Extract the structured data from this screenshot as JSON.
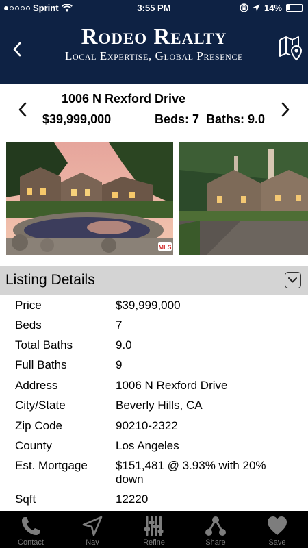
{
  "status_bar": {
    "carrier": "Sprint",
    "time": "3:55 PM",
    "battery": "14%",
    "battery_level": 0.14
  },
  "header": {
    "title": "Rodeo Realty",
    "subtitle": "Local Expertise, Global Presence"
  },
  "listing": {
    "address": "1006 N Rexford Drive",
    "price": "$39,999,000",
    "beds_baths": "Beds: 7  Baths: 9.0"
  },
  "details": {
    "title": "Listing Details",
    "rows": [
      {
        "key": "Price",
        "value": "$39,999,000"
      },
      {
        "key": "Beds",
        "value": "7"
      },
      {
        "key": "Total Baths",
        "value": "9.0"
      },
      {
        "key": "Full Baths",
        "value": "9"
      },
      {
        "key": "Address",
        "value": "1006 N Rexford Drive"
      },
      {
        "key": "City/State",
        "value": "Beverly Hills, CA"
      },
      {
        "key": "Zip Code",
        "value": "90210-2322"
      },
      {
        "key": "County",
        "value": "Los Angeles"
      },
      {
        "key": "Est. Mortgage",
        "value": "$151,481 @ 3.93% with 20% down"
      },
      {
        "key": "Sqft",
        "value": "12220"
      }
    ]
  },
  "photos": {
    "badge": "MLS"
  },
  "tabs": [
    {
      "label": "Contact",
      "icon": "phone-icon"
    },
    {
      "label": "Nav",
      "icon": "navigation-arrow-icon"
    },
    {
      "label": "Refine",
      "icon": "sliders-icon"
    },
    {
      "label": "Share",
      "icon": "share-icon"
    },
    {
      "label": "Save",
      "icon": "heart-icon"
    }
  ],
  "colors": {
    "header_bg": "#0e2244",
    "details_bar": "#d4d4d4",
    "tabbar_bg": "#000000",
    "tab_inactive": "#7d7d7d"
  }
}
